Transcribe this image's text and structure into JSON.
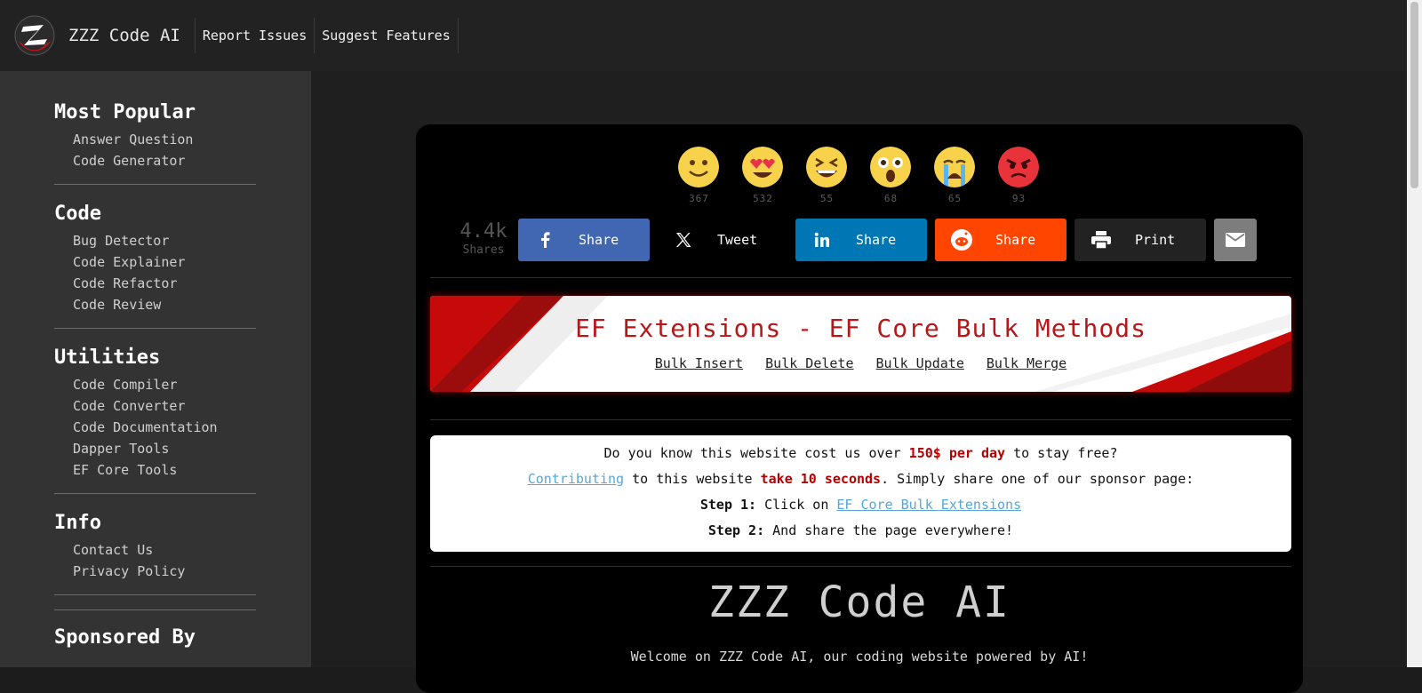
{
  "header": {
    "brand": "ZZZ Code AI",
    "nav": [
      "Report Issues",
      "Suggest Features"
    ]
  },
  "sidebar": {
    "sections": [
      {
        "title": "Most Popular",
        "items": [
          "Answer Question",
          "Code Generator"
        ]
      },
      {
        "title": "Code",
        "items": [
          "Bug Detector",
          "Code Explainer",
          "Code Refactor",
          "Code Review"
        ]
      },
      {
        "title": "Utilities",
        "items": [
          "Code Compiler",
          "Code Converter",
          "Code Documentation",
          "Dapper Tools",
          "EF Core Tools"
        ]
      },
      {
        "title": "Info",
        "items": [
          "Contact Us",
          "Privacy Policy"
        ]
      }
    ],
    "sponsored_title": "Sponsored By"
  },
  "reactions": [
    {
      "name": "smile-emoji-icon",
      "count": "367"
    },
    {
      "name": "heart-eyes-emoji-icon",
      "count": "532"
    },
    {
      "name": "laughing-emoji-icon",
      "count": "55"
    },
    {
      "name": "surprised-emoji-icon",
      "count": "68"
    },
    {
      "name": "crying-emoji-icon",
      "count": "65"
    },
    {
      "name": "angry-emoji-icon",
      "count": "93"
    }
  ],
  "shares": {
    "total": "4.4k",
    "total_label": "Shares",
    "buttons": [
      {
        "name": "facebook",
        "label": "Share",
        "color": "#3b5998",
        "icon": "facebook-icon"
      },
      {
        "name": "twitter",
        "label": "Tweet",
        "color": "#000000",
        "icon": "x-icon"
      },
      {
        "name": "linkedin",
        "label": "Share",
        "color": "#0077b5",
        "icon": "linkedin-icon"
      },
      {
        "name": "reddit",
        "label": "Share",
        "color": "#ff4500",
        "icon": "reddit-icon"
      },
      {
        "name": "print",
        "label": "Print",
        "color": "#222222",
        "icon": "printer-icon"
      },
      {
        "name": "email",
        "label": "",
        "color": "#7d7d7d",
        "icon": "mail-icon"
      }
    ]
  },
  "banner": {
    "title": "EF Extensions - EF Core Bulk Methods",
    "links": [
      "Bulk Insert",
      "Bulk Delete",
      "Bulk Update",
      "Bulk Merge"
    ]
  },
  "info": {
    "l1_a": "Do you know this website cost us over ",
    "l1_b": "150$ per day",
    "l1_c": " to stay free?",
    "l2_link": "Contributing",
    "l2_a": " to this website ",
    "l2_b": "take 10 seconds",
    "l2_c": ". Simply share one of our sponsor page:",
    "l3_step": "Step 1:",
    "l3_a": " Click on ",
    "l3_link": "EF Core Bulk Extensions",
    "l4_step": "Step 2:",
    "l4_a": " And share the page everywhere!"
  },
  "main": {
    "title": "ZZZ Code AI",
    "welcome": "Welcome on ZZZ Code AI, our coding website powered by AI!"
  }
}
